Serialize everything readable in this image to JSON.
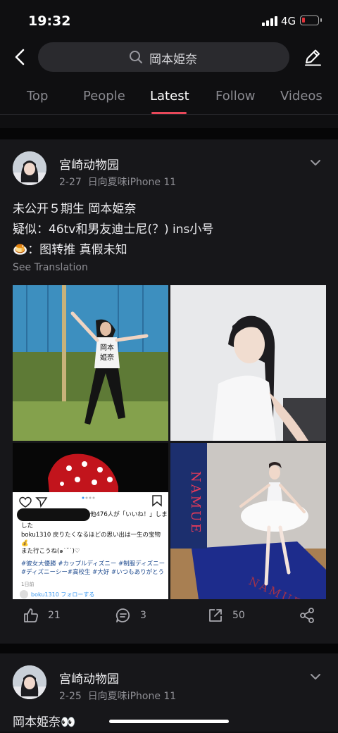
{
  "status": {
    "time": "19:32",
    "network": "4G"
  },
  "search": {
    "query": "岡本姫奈"
  },
  "tabs": [
    {
      "label": "Top"
    },
    {
      "label": "People"
    },
    {
      "label": "Latest"
    },
    {
      "label": "Follow"
    },
    {
      "label": "Videos"
    }
  ],
  "active_tab": "Latest",
  "posts": [
    {
      "username": "宫崎动物园",
      "date": "2-27",
      "device": "日向夏味iPhone 11",
      "lines": [
        "未公开５期生 岡本姫奈",
        "疑似：46tv和男友迪士尼(？) ins小号",
        "🍮：图转推 真假未知"
      ],
      "translate": "See Translation",
      "images": {
        "shirt_text": "岡本\n姫奈",
        "ig_line1": "他476人が「いいね！」しま",
        "ig_line1b": "した",
        "ig_line2": "boku1310 戻りたくなるほどの思い出は一生の宝物 💰",
        "ig_line3": "また行こうね(๑˙˘˙)♡",
        "ig_line4": "#彼女大優勝 #カップルディズニー #制服ディズニー #ディズニーシー#高校生 #大好 #いつもありがとう",
        "ig_line5": "1日前",
        "ig_line6": "boku1310 フォローする",
        "banner": "NAMUE"
      },
      "likes": "21",
      "comments": "3",
      "shares": "50"
    },
    {
      "username": "宫崎动物园",
      "date": "2-25",
      "device": "日向夏味iPhone 11",
      "text": "岡本姫奈👀"
    }
  ]
}
